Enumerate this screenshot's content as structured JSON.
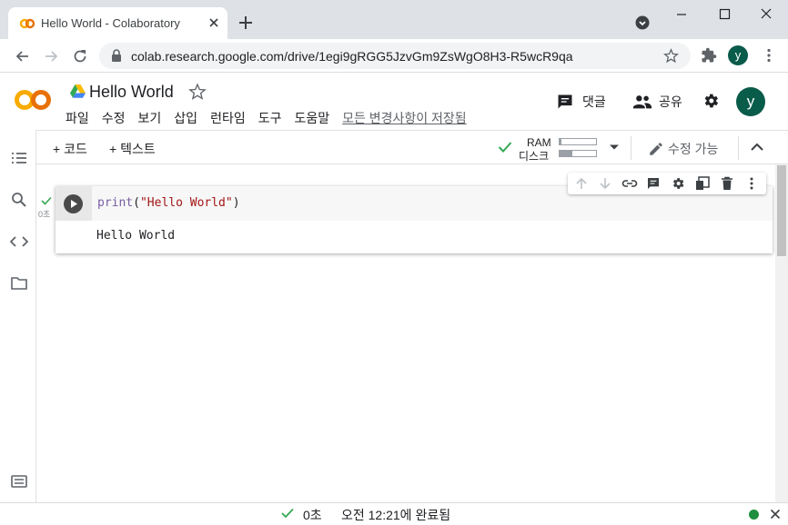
{
  "browser": {
    "tab_title": "Hello World - Colaboratory",
    "url": "colab.research.google.com/drive/1egi9gRGG5JzvGm9ZsWgO8H3-R5wcR9qa",
    "profile_initial": "y"
  },
  "header": {
    "logo_text": "CO",
    "doc_title": "Hello World",
    "menu": [
      "파일",
      "수정",
      "보기",
      "삽입",
      "런타임",
      "도구",
      "도움말"
    ],
    "save_status": "모든 변경사항이 저장됨",
    "comment_label": "댓글",
    "share_label": "공유",
    "avatar_initial": "y"
  },
  "toolbar": {
    "add_code_label": "+ 코드",
    "add_text_label": "+ 텍스트",
    "ram_label": "RAM",
    "disk_label": "디스크",
    "ram_usage": 0.05,
    "disk_usage": 0.35,
    "edit_label": "수정 가능"
  },
  "cell": {
    "exec_time": "0초",
    "code_fn": "print",
    "code_open": "(",
    "code_string": "\"Hello World\"",
    "code_close": ")",
    "output": "Hello World"
  },
  "status": {
    "duration": "0초",
    "completed": "오전 12:21에 완료됨"
  },
  "colors": {
    "accent_orange": "#f9ab00",
    "success_green": "#34a853",
    "string_red": "#a31515",
    "fn_purple": "#795da3"
  },
  "icons": [
    "colab-logo-icon",
    "drive-icon",
    "star-icon",
    "comment-icon",
    "share-people-icon",
    "settings-gear-icon",
    "chevron-up-icon",
    "pencil-icon",
    "dropdown-icon",
    "toc-icon",
    "search-icon",
    "code-snippets-icon",
    "folder-icon",
    "terminal-icon",
    "run-icon",
    "arrow-up-icon",
    "arrow-down-icon",
    "link-icon",
    "comment-icon",
    "gear-icon",
    "mirror-cell-icon",
    "trash-icon",
    "more-vert-icon",
    "check-icon",
    "close-icon"
  ]
}
